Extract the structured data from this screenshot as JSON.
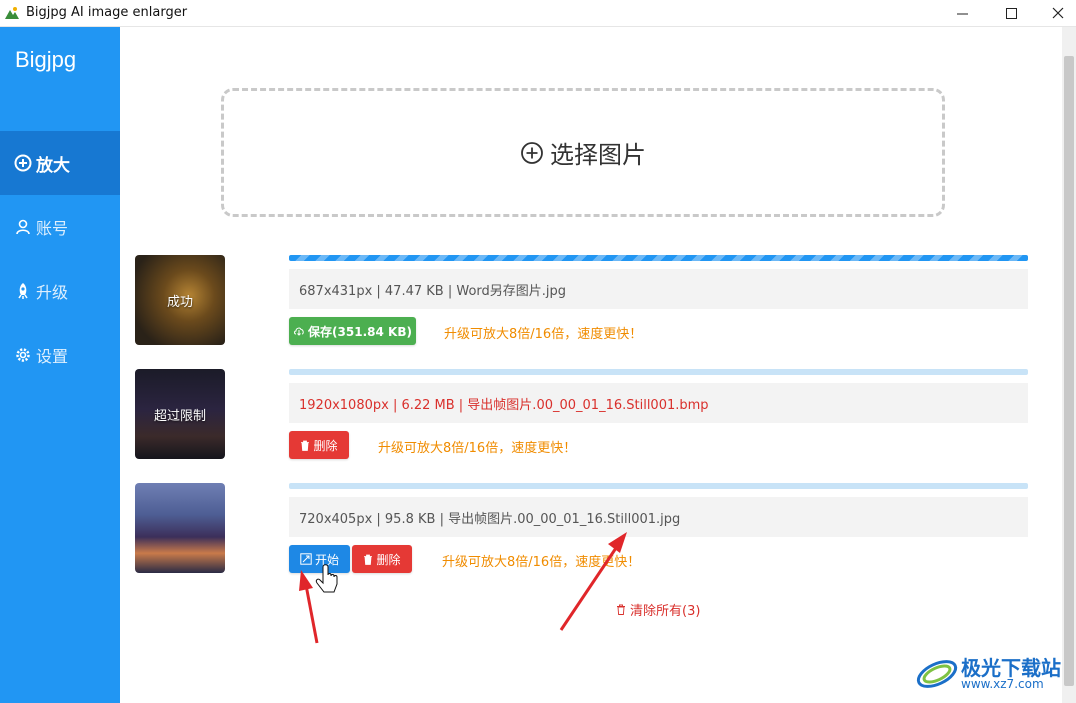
{
  "window": {
    "title": "Bigjpg AI image enlarger",
    "minimize_glyph": "—",
    "maximize_glyph": "☐",
    "close_glyph": "✕"
  },
  "sidebar": {
    "brand": "Bigjpg",
    "items": [
      {
        "label": "放大",
        "icon": "plus-circle-icon",
        "active": true
      },
      {
        "label": "账号",
        "icon": "user-icon",
        "active": false
      },
      {
        "label": "升级",
        "icon": "rocket-icon",
        "active": false
      },
      {
        "label": "设置",
        "icon": "gear-icon",
        "active": false
      }
    ]
  },
  "main": {
    "select_image_label": "选择图片",
    "files": [
      {
        "status": "成功",
        "info": "687x431px | 47.47 KB | Word另存图片.jpg",
        "progress": 1.0,
        "save_label": "保存(351.84 KB)",
        "upgrade_tip": "升级可放大8倍/16倍，速度更快！"
      },
      {
        "status": "超过限制",
        "info": "1920x1080px | 6.22 MB | 导出帧图片.00_00_01_16.Still001.bmp",
        "progress": 1.0,
        "delete_label": "删除",
        "upgrade_tip": "升级可放大8倍/16倍，速度更快！"
      },
      {
        "status": "",
        "info": "720x405px | 95.8 KB | 导出帧图片.00_00_01_16.Still001.jpg",
        "progress": 1.0,
        "start_label": "开始",
        "delete_label": "删除",
        "upgrade_tip": "升级可放大8倍/16倍，速度更快！"
      }
    ],
    "clear_all_label": "清除所有(3)"
  },
  "colors": {
    "sidebar_bg": "#2196f3",
    "sidebar_active": "#1778d2",
    "save_green": "#4caf50",
    "delete_red": "#e53935",
    "start_blue": "#1e88e5",
    "tip_orange": "#f08c00",
    "annotation_red": "#e0262a"
  },
  "watermark": {
    "text": "极光下载站",
    "url": "www.xz7.com"
  }
}
